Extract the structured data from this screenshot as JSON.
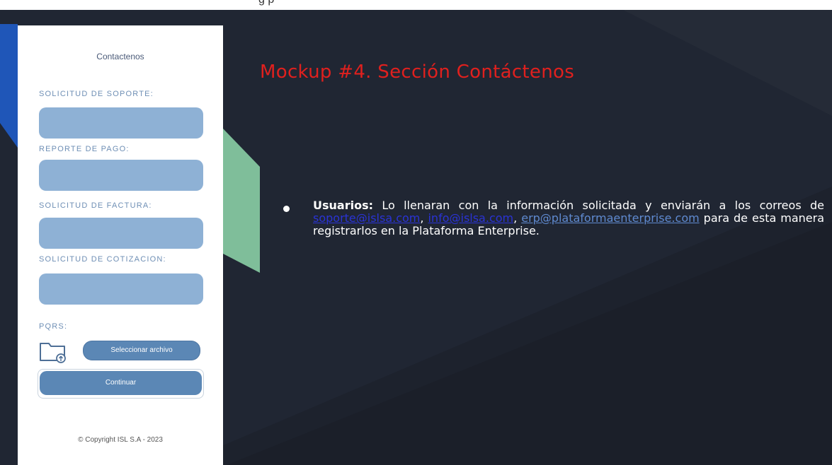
{
  "top_fragment": "g              p",
  "heading": "Mockup #4. Sección Contáctenos",
  "phone": {
    "title": "Contactenos",
    "labels": {
      "soporte": "SOLICITUD DE SOPORTE:",
      "pago": "REPORTE DE PAGO:",
      "factura": "SOLICITUD DE FACTURA:",
      "cotizacion": "SOLICITUD DE COTIZACION:",
      "pqrs": "PQRS:"
    },
    "file_button": "Seleccionar archivo",
    "continue_button": "Continuar",
    "copyright": "© Copyright ISL S.A - 2023"
  },
  "description": {
    "bold": "Usuarios:",
    "part1": " Lo llenaran con la información solicitada y enviarán a los correos de ",
    "email1": "soporte@islsa.com",
    "sep1": ", ",
    "email2": "info@islsa.com",
    "sep2": ", ",
    "email3": "erp@plataformaenterprise.com",
    "part2": " para de esta manera registrarlos en la Plataforma Enterprise."
  },
  "colors": {
    "background": "#1d222d",
    "heading": "#e0201e",
    "field": "#8eb1d5",
    "button": "#5b87b5",
    "accent_green": "#7fbe9a",
    "accent_blue": "#1f56b8"
  },
  "icons": [
    "folder-attach-icon",
    "bullet-icon"
  ]
}
